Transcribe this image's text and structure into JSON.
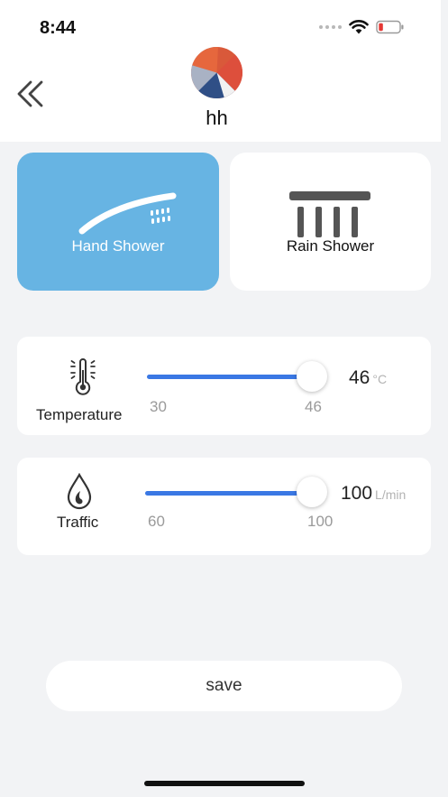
{
  "status_bar": {
    "time": "8:44"
  },
  "header": {
    "username": "hh"
  },
  "modes": [
    {
      "label": "Hand Shower",
      "selected": true
    },
    {
      "label": "Rain Shower",
      "selected": false
    }
  ],
  "temperature": {
    "label": "Temperature",
    "min": "30",
    "max": "46",
    "value": "46",
    "unit": "°C"
  },
  "traffic": {
    "label": "Traffic",
    "min": "60",
    "max": "100",
    "value": "100",
    "unit": "L/min"
  },
  "save_label": "save",
  "colors": {
    "accent": "#3a78e4",
    "selected_card": "#67b4e3",
    "battery_low": "#e53935"
  }
}
